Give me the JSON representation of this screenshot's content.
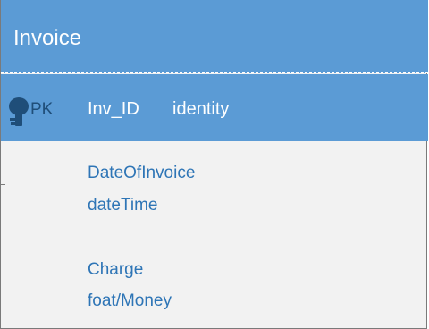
{
  "entity": {
    "title": "Invoice",
    "primary_key": {
      "label": "PK",
      "name": "Inv_ID",
      "type": "identity"
    },
    "attributes": [
      {
        "name": "DateOfInvoice",
        "type": "dateTime"
      },
      {
        "name": "Charge",
        "type": "foat/Money"
      }
    ]
  },
  "colors": {
    "header_bg": "#5b9bd5",
    "body_bg": "#f2f2f2",
    "attribute_text": "#2e75b6",
    "key_icon": "#1f4e79"
  },
  "icons": {
    "primary_key": "key-icon"
  }
}
